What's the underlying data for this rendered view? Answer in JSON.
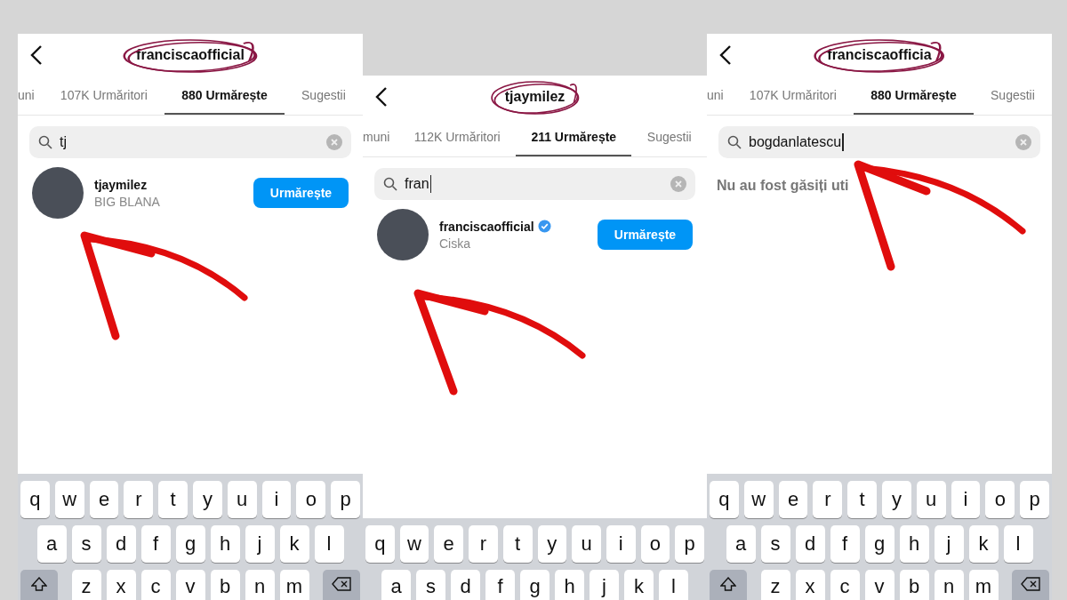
{
  "panels": [
    {
      "title": "franciscaofficial",
      "tabs": [
        {
          "label": "uni",
          "selected": false
        },
        {
          "label": "107K Urmăritori",
          "selected": false
        },
        {
          "label": "880 Urmărește",
          "selected": true
        },
        {
          "label": "Sugestii",
          "selected": false
        }
      ],
      "search": {
        "value": "tj",
        "cursor": false
      },
      "results": [
        {
          "username": "tjaymilez",
          "verified": false,
          "name": "BIG BLANA",
          "button": "Urmărește"
        }
      ],
      "keyboard": [
        [
          "q",
          "w",
          "e",
          "r",
          "t",
          "y",
          "u",
          "i",
          "o",
          "p"
        ],
        [
          "a",
          "s",
          "d",
          "f",
          "g",
          "h",
          "j",
          "k",
          "l"
        ],
        [
          "z",
          "x",
          "c",
          "v",
          "b",
          "n",
          "m"
        ]
      ]
    },
    {
      "title": "tjaymilez",
      "tabs": [
        {
          "label": "muni",
          "selected": false
        },
        {
          "label": "112K Urmăritori",
          "selected": false
        },
        {
          "label": "211 Urmărește",
          "selected": true
        },
        {
          "label": "Sugestii",
          "selected": false
        }
      ],
      "search": {
        "value": "fran",
        "cursor": true
      },
      "results": [
        {
          "username": "franciscaofficial",
          "verified": true,
          "name": "Ciska",
          "button": "Urmărește"
        }
      ],
      "keyboard": [
        [
          "q",
          "w",
          "e",
          "r",
          "t",
          "y",
          "u",
          "i",
          "o",
          "p"
        ],
        [
          "a",
          "s",
          "d",
          "f",
          "g",
          "h",
          "j",
          "k",
          "l"
        ]
      ]
    },
    {
      "title": "franciscaofficia",
      "tabs": [
        {
          "label": "uni",
          "selected": false
        },
        {
          "label": "107K Urmăritori",
          "selected": false
        },
        {
          "label": "880 Urmărește",
          "selected": true
        },
        {
          "label": "Sugestii",
          "selected": false
        }
      ],
      "search": {
        "value": "bogdanlatescu",
        "cursor": true
      },
      "message": "Nu au fost găsiți uti",
      "keyboard": [
        [
          "q",
          "w",
          "e",
          "r",
          "t",
          "y",
          "u",
          "i",
          "o",
          "p"
        ],
        [
          "a",
          "s",
          "d",
          "f",
          "g",
          "h",
          "j",
          "k",
          "l"
        ],
        [
          "z",
          "x",
          "c",
          "v",
          "b",
          "n",
          "m"
        ]
      ]
    }
  ]
}
